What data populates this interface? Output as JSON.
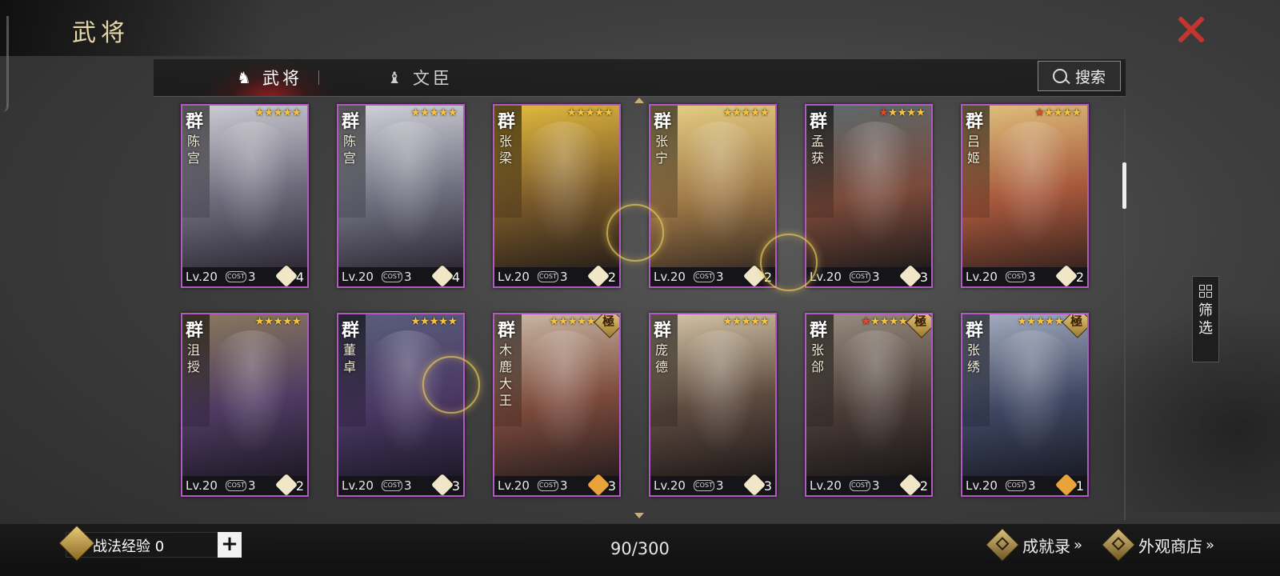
{
  "title": "武将",
  "tabs": [
    {
      "label": "武将",
      "icon": "general-helmet-icon",
      "active": true
    },
    {
      "label": "文臣",
      "icon": "minister-icon",
      "active": false
    }
  ],
  "search": {
    "label": "搜索",
    "icon": "search-icon"
  },
  "filter": {
    "label": "筛选",
    "icon": "grid-filter-icon"
  },
  "cards": [
    {
      "faction": "群",
      "name": "陈宫",
      "level": "Lv.20",
      "cost_label": "COST",
      "cost": "3",
      "unit": "4",
      "unit_icon": "bow-icon",
      "stars": "★★★★★",
      "red_stars": "",
      "badge": "",
      "palette": [
        "#cfcfd6",
        "#6d6b7b",
        "#2e2a36"
      ]
    },
    {
      "faction": "群",
      "name": "陈宫",
      "level": "Lv.20",
      "cost_label": "COST",
      "cost": "3",
      "unit": "4",
      "unit_icon": "bow-icon",
      "stars": "★★★★★",
      "red_stars": "",
      "badge": "",
      "palette": [
        "#d3d3da",
        "#707080",
        "#2e2a36"
      ]
    },
    {
      "faction": "群",
      "name": "张梁",
      "level": "Lv.20",
      "cost_label": "COST",
      "cost": "3",
      "unit": "2",
      "unit_icon": "cavalry-icon",
      "stars": "★★★★★",
      "red_stars": "",
      "badge": "",
      "palette": [
        "#e4bb3f",
        "#7b5a2a",
        "#2a2119"
      ]
    },
    {
      "faction": "群",
      "name": "张宁",
      "level": "Lv.20",
      "cost_label": "COST",
      "cost": "3",
      "unit": "2",
      "unit_icon": "cavalry-icon",
      "stars": "★★★★★",
      "red_stars": "",
      "badge": "",
      "palette": [
        "#e7cf84",
        "#a07a48",
        "#3b2d22"
      ]
    },
    {
      "faction": "群",
      "name": "孟获",
      "level": "Lv.20",
      "cost_label": "COST",
      "cost": "3",
      "unit": "3",
      "unit_icon": "cavalry-icon",
      "stars": "★★★★",
      "red_stars": "★",
      "badge": "",
      "palette": [
        "#5d6a6e",
        "#7a4a3a",
        "#221c1c"
      ]
    },
    {
      "faction": "群",
      "name": "吕姬",
      "level": "Lv.20",
      "cost_label": "COST",
      "cost": "3",
      "unit": "2",
      "unit_icon": "cavalry-icon",
      "stars": "★★★★",
      "red_stars": "★",
      "badge": "",
      "palette": [
        "#e1c27e",
        "#a7583c",
        "#3a241f"
      ]
    },
    {
      "faction": "群",
      "name": "沮授",
      "level": "Lv.20",
      "cost_label": "COST",
      "cost": "3",
      "unit": "2",
      "unit_icon": "cavalry-icon",
      "stars": "★★★★★",
      "red_stars": "",
      "badge": "",
      "palette": [
        "#8a7a5d",
        "#4f3b63",
        "#1f1a26"
      ]
    },
    {
      "faction": "群",
      "name": "董卓",
      "level": "Lv.20",
      "cost_label": "COST",
      "cost": "3",
      "unit": "3",
      "unit_icon": "shield-icon",
      "stars": "★★★★★",
      "red_stars": "",
      "badge": "",
      "palette": [
        "#5a5f7d",
        "#4b3864",
        "#1d1a2a"
      ]
    },
    {
      "faction": "群",
      "name": "木鹿大王",
      "level": "Lv.20",
      "cost_label": "COST",
      "cost": "3",
      "unit": "3",
      "unit_icon": "cavalry-red-icon",
      "stars": "★★★★★",
      "red_stars": "",
      "badge": "極",
      "palette": [
        "#cbb9a6",
        "#7c4a3c",
        "#2a1f20"
      ]
    },
    {
      "faction": "群",
      "name": "庞德",
      "level": "Lv.20",
      "cost_label": "COST",
      "cost": "3",
      "unit": "3",
      "unit_icon": "shield-icon",
      "stars": "★★★★★",
      "red_stars": "",
      "badge": "",
      "palette": [
        "#d6c6a8",
        "#5d4a3f",
        "#1f1a1a"
      ]
    },
    {
      "faction": "群",
      "name": "张郃",
      "level": "Lv.20",
      "cost_label": "COST",
      "cost": "3",
      "unit": "2",
      "unit_icon": "shield-icon",
      "stars": "★★★★",
      "red_stars": "★",
      "badge": "極",
      "palette": [
        "#9a8f82",
        "#4a3d38",
        "#1b1717"
      ]
    },
    {
      "faction": "群",
      "name": "张绣",
      "level": "Lv.20",
      "cost_label": "COST",
      "cost": "3",
      "unit": "1",
      "unit_icon": "cavalry-red-icon",
      "stars": "★★★★★",
      "red_stars": "",
      "badge": "極",
      "palette": [
        "#a7afc2",
        "#3f4763",
        "#1a1c26"
      ]
    }
  ],
  "bottom": {
    "exp_label": "战法经验",
    "exp_value": "0",
    "exp_icon": "tactics-exp-icon",
    "plus_label": "+",
    "count": "90/300",
    "achievements_label": "成就录",
    "achievements_icon": "achievement-icon",
    "shop_label": "外观商店",
    "shop_icon": "shop-icon",
    "chevron": "»"
  },
  "colors": {
    "accent": "#b259c4",
    "close": "#c3362f",
    "gold": "#f4c342"
  }
}
